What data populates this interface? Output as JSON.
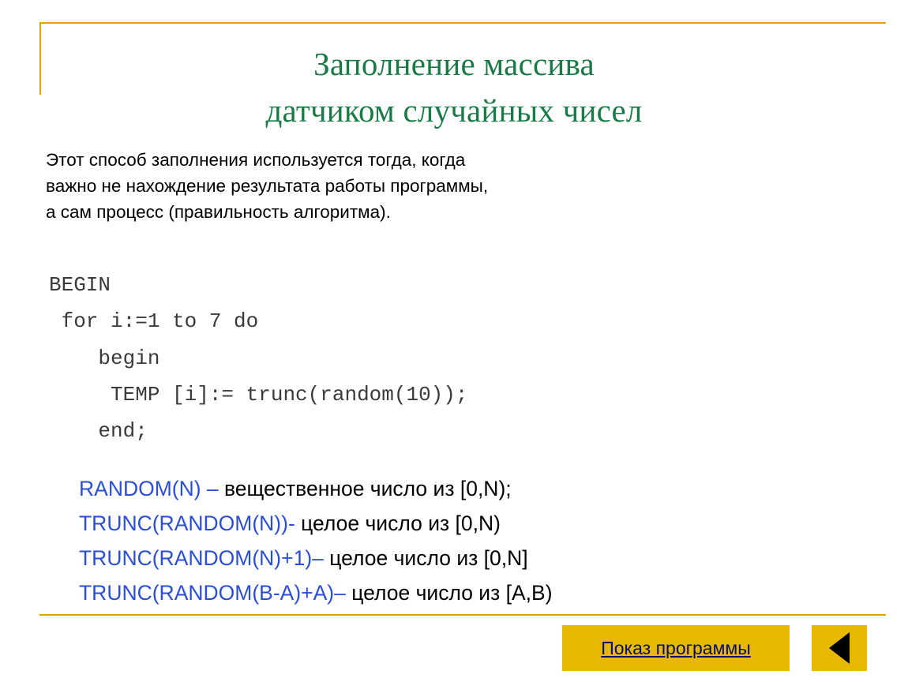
{
  "slide": {
    "title_line1": "Заполнение массива",
    "title_line2": "датчиком случайных чисел",
    "intro_line1": "Этот способ заполнения используется тогда, когда",
    "intro_line2": "важно не нахождение результата работы программы,",
    "intro_line3": "а сам процесс (правильность алгоритма).",
    "code": "BEGIN\n for i:=1 to 7 do\n    begin\n     TEMP [i]:= trunc(random(10));\n    end;",
    "legend": [
      {
        "blue": "RANDOM(N) – ",
        "rest": "вещественное число из [0,N);"
      },
      {
        "blue": "TRUNC(RANDOM(N))- ",
        "rest": "целое число из [0,N)"
      },
      {
        "blue": "TRUNC(RANDOM(N)+1)– ",
        "rest": "целое число из [0,N]"
      },
      {
        "blue": "TRUNC(RANDOM(B-A)+A)– ",
        "rest": "целое число из [A,B)"
      }
    ],
    "show_program_label": "Показ программы",
    "back_icon": "back-triangle-icon",
    "colors": {
      "title": "#1a7a46",
      "frame": "#d9a300",
      "accent_blue": "#2a4fd6",
      "button_bg": "#e8b800",
      "button_text": "#0a0a6e"
    }
  }
}
